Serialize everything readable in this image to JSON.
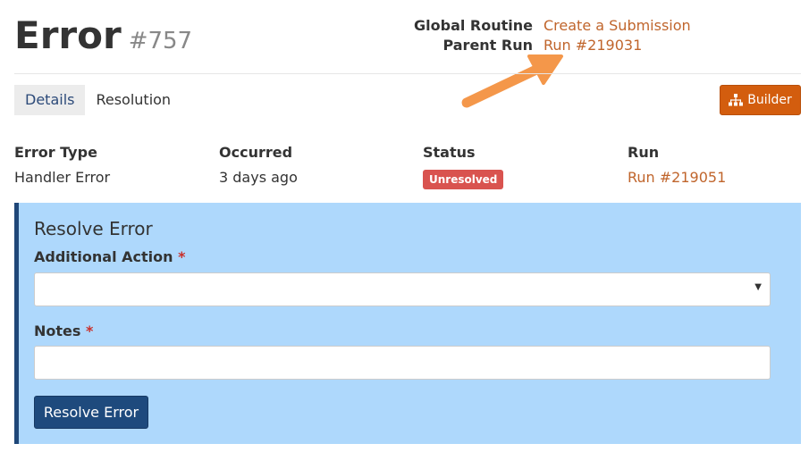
{
  "page": {
    "title": "Error",
    "number": "#757"
  },
  "meta": {
    "global_routine_label": "Global Routine",
    "global_routine_value": "Create a Submission",
    "parent_run_label": "Parent Run",
    "parent_run_value": "Run #219031"
  },
  "tabs": [
    {
      "label": "Details",
      "active": true
    },
    {
      "label": "Resolution",
      "active": false
    }
  ],
  "toolbar": {
    "builder_label": "Builder",
    "builder_icon": "sitemap-icon"
  },
  "details": {
    "error_type_label": "Error Type",
    "error_type_value": "Handler Error",
    "occurred_label": "Occurred",
    "occurred_value": "3 days ago",
    "status_label": "Status",
    "status_value": "Unresolved",
    "run_label": "Run",
    "run_value": "Run #219051"
  },
  "resolve": {
    "title": "Resolve Error",
    "action_label": "Additional Action",
    "action_value": "",
    "notes_label": "Notes",
    "notes_value": "",
    "required_marker": "*",
    "submit_label": "Resolve Error"
  },
  "colors": {
    "link": "#c0652c",
    "builder_button": "#d35d0e",
    "panel_background": "#aed8fc",
    "panel_border": "#1f4778",
    "primary_button": "#1e4a7d",
    "status_badge": "#d9534f",
    "annotation_arrow": "#f4974a"
  }
}
